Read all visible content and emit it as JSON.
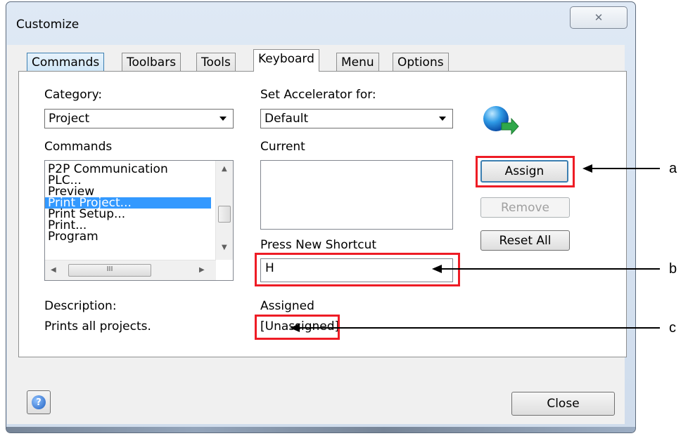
{
  "window": {
    "title": "Customize",
    "close_glyph": "✕"
  },
  "tabs": [
    {
      "label": "Commands",
      "state": "hover"
    },
    {
      "label": "Toolbars",
      "state": "normal"
    },
    {
      "label": "Tools",
      "state": "normal"
    },
    {
      "label": "Keyboard",
      "state": "active"
    },
    {
      "label": "Menu",
      "state": "normal"
    },
    {
      "label": "Options",
      "state": "normal"
    }
  ],
  "keyboard": {
    "category_label": "Category:",
    "category_value": "Project",
    "commands_label": "Commands",
    "commands": [
      "P2P Communication",
      "PLC...",
      "Preview",
      "Print Project...",
      "Print Setup...",
      "Print...",
      "Program"
    ],
    "selected_command": "Print Project...",
    "description_label": "Description:",
    "description_text": "Prints all projects.",
    "set_accel_label": "Set Accelerator for:",
    "set_accel_value": "Default",
    "current_label": "Current",
    "press_new_label": "Press New Shortcut",
    "shortcut_value": "H",
    "assigned_label": "Assigned",
    "assigned_value": "[Unassigned]",
    "hscroll_grip": "III"
  },
  "buttons": {
    "assign": "Assign",
    "remove": "Remove",
    "reset_all": "Reset All",
    "close": "Close",
    "help": "?"
  },
  "callouts": {
    "a": "a",
    "b": "b",
    "c": "c"
  },
  "colors": {
    "highlight": "#ee1c25",
    "selection": "#3399ff"
  }
}
